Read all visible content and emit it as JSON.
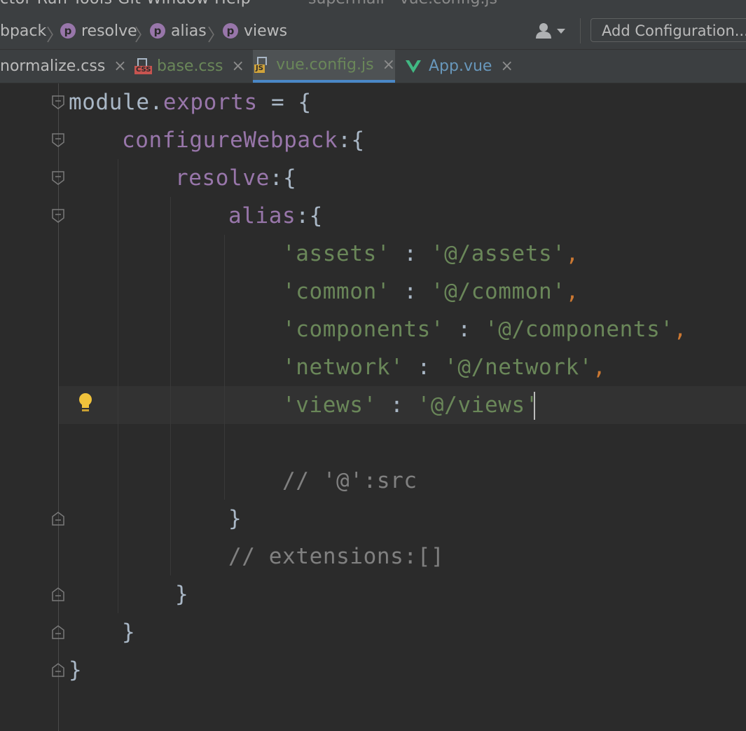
{
  "menu": {
    "items_text": "ctor  Run  Tools  Git  Window  Help",
    "window_title": "supermall - vue.config.js"
  },
  "breadcrumb": [
    {
      "label": "bpack",
      "icon": ""
    },
    {
      "label": "resolve",
      "icon": "p"
    },
    {
      "label": "alias",
      "icon": "p"
    },
    {
      "label": "views",
      "icon": "p"
    }
  ],
  "toolbar": {
    "add_configuration_label": "Add Configuration..."
  },
  "tabs": [
    {
      "label": "normalize.css",
      "icon": "",
      "color": "#bbbbbb"
    },
    {
      "label": "base.css",
      "icon": "css-file-icon",
      "badge": "CSS",
      "color": "#6a8759"
    },
    {
      "label": "vue.config.js",
      "icon": "js-file-icon",
      "badge": "JS",
      "color": "#6a8759",
      "active": true
    },
    {
      "label": "App.vue",
      "icon": "vue-file-icon",
      "color": "#6897bb"
    }
  ],
  "code": {
    "l1_a": "module.",
    "l1_b": "exports",
    "l1_c": " = {",
    "l2_a": "configureWebpack",
    "l2_b": ":{",
    "l3_a": "resolve",
    "l3_b": ":{",
    "l4_a": "alias",
    "l4_b": ":{",
    "l5_key": "'assets'",
    "l5_sep": " : ",
    "l5_val": "'@/assets'",
    "l5_comma": ",",
    "l6_key": "'common'",
    "l6_sep": " : ",
    "l6_val": "'@/common'",
    "l6_comma": ",",
    "l7_key": "'components'",
    "l7_sep": " : ",
    "l7_val": "'@/components'",
    "l7_comma": ",",
    "l8_key": "'network'",
    "l8_sep": " : ",
    "l8_val": "'@/network'",
    "l8_comma": ",",
    "l9_key": "'views'",
    "l9_sep": " : ",
    "l9_val": "'@/views'",
    "l11": "// '@':src",
    "l12": "}",
    "l13": "// extensions:[]",
    "l14": "}",
    "l15": "}",
    "l16": "}"
  },
  "colors": {
    "background": "#2b2b2b",
    "property": "#9876aa",
    "string": "#6a8759",
    "comma": "#cc7832",
    "comment": "#808080",
    "text": "#a9b7c6",
    "active_tab_underline": "#4a88c7",
    "bulb": "#f0c23b"
  }
}
